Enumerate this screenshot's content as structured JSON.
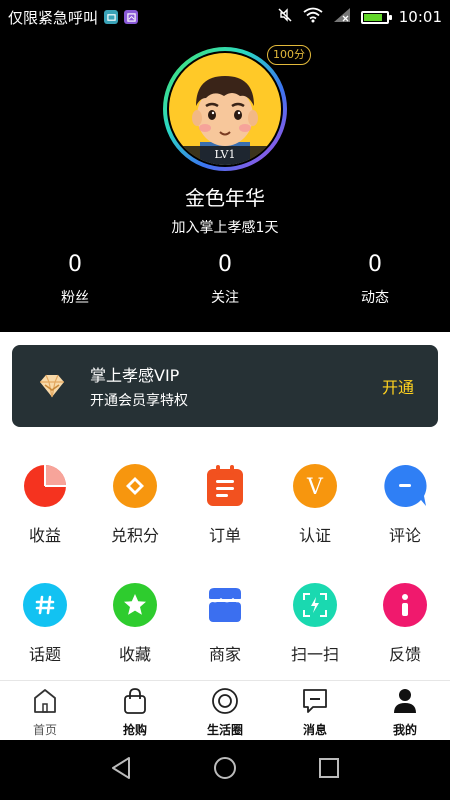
{
  "status_bar": {
    "carrier": "仅限紧急呼叫",
    "time": "10:01",
    "battery_percent": 85
  },
  "profile": {
    "points_badge": "100分",
    "level": "LV1",
    "nickname": "金色年华",
    "join_text": "加入掌上孝感1天",
    "stats": [
      {
        "value": "0",
        "label": "粉丝"
      },
      {
        "value": "0",
        "label": "关注"
      },
      {
        "value": "0",
        "label": "动态"
      }
    ]
  },
  "vip": {
    "title": "掌上孝感VIP",
    "subtitle": "开通会员享特权",
    "action": "开通",
    "action_color": "#ffd21f"
  },
  "grid": {
    "row1": [
      {
        "label": "收益",
        "icon": "pie-chart-icon",
        "color": "#f5331f"
      },
      {
        "label": "兑积分",
        "icon": "diamond-icon",
        "color": "#f7960e"
      },
      {
        "label": "订单",
        "icon": "clipboard-icon",
        "color": "#f2511f"
      },
      {
        "label": "认证",
        "icon": "v-icon",
        "color": "#f7960e"
      },
      {
        "label": "评论",
        "icon": "chat-bubble-icon",
        "color": "#2f7ff5"
      }
    ],
    "row2": [
      {
        "label": "话题",
        "icon": "hash-icon",
        "color": "#12c2f2"
      },
      {
        "label": "收藏",
        "icon": "star-icon",
        "color": "#2ecc2e"
      },
      {
        "label": "商家",
        "icon": "store-icon",
        "color": "#3b6ff0"
      },
      {
        "label": "扫一扫",
        "icon": "scan-icon",
        "color": "#1ad9b0"
      },
      {
        "label": "反馈",
        "icon": "info-icon",
        "color": "#f0196d"
      }
    ]
  },
  "tabs": [
    {
      "label": "首页",
      "icon": "home-icon"
    },
    {
      "label": "抢购",
      "icon": "shopping-bag-icon"
    },
    {
      "label": "生活圈",
      "icon": "circle-target-icon"
    },
    {
      "label": "消息",
      "icon": "message-icon"
    },
    {
      "label": "我的",
      "icon": "person-icon"
    }
  ]
}
